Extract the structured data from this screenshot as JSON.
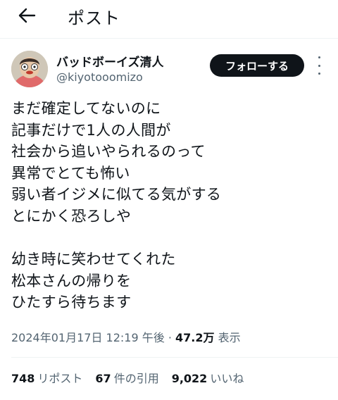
{
  "header": {
    "back_icon": "arrow-left-icon",
    "title": "ポスト"
  },
  "author": {
    "display_name": "バッドボーイズ清人",
    "handle": "@kiyotooomizo",
    "avatar_icon": "avatar-photo"
  },
  "actions": {
    "follow_label": "フォローする",
    "more_icon": "more-vertical-icon"
  },
  "tweet": {
    "lines": [
      "まだ確定してないのに",
      "記事だけで1人の人間が",
      "社会から追いやられるのって",
      "異常でとても怖い",
      "弱い者イジメに似てる気がする",
      "とにかく恐ろしや",
      "",
      "幼き時に笑わせてくれた",
      "松本さんの帰りを",
      "ひたすら待ちます"
    ],
    "timestamp": "2024年01月17日 12:19 午後",
    "separator": "·",
    "views_count": "47.2万",
    "views_label": "表示"
  },
  "stats": {
    "reposts": {
      "count": "748",
      "label": "リポスト"
    },
    "quotes": {
      "count": "67",
      "label": "件の引用"
    },
    "likes": {
      "count": "9,022",
      "label": "いいね"
    }
  },
  "colors": {
    "text": "#0f1419",
    "muted": "#536471",
    "divider": "#eff3f4",
    "follow_bg": "#0f1419"
  }
}
